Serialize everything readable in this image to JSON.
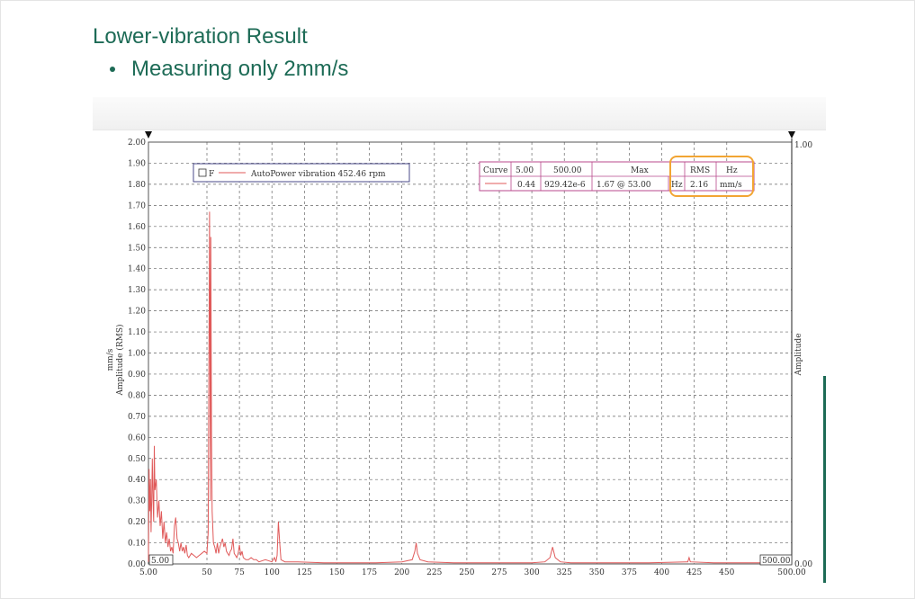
{
  "page": {
    "heading": "Lower-vibration Result",
    "bullet": "Measuring only 2mm/s"
  },
  "chart_data": {
    "type": "line",
    "series": [
      {
        "name": "AutoPower vibration 452.46 rpm",
        "color": "#e05a5a",
        "points": [
          [
            5,
            0.01
          ],
          [
            5.5,
            0.45
          ],
          [
            6,
            0.25
          ],
          [
            6.5,
            0.4
          ],
          [
            7,
            0.15
          ],
          [
            7.5,
            0.3
          ],
          [
            8,
            0.5
          ],
          [
            8.5,
            0.3
          ],
          [
            9,
            0.2
          ],
          [
            9.5,
            0.56
          ],
          [
            10,
            0.35
          ],
          [
            11,
            0.4
          ],
          [
            12,
            0.22
          ],
          [
            13,
            0.3
          ],
          [
            14,
            0.18
          ],
          [
            15,
            0.25
          ],
          [
            16,
            0.12
          ],
          [
            17,
            0.2
          ],
          [
            18,
            0.1
          ],
          [
            19,
            0.15
          ],
          [
            20,
            0.08
          ],
          [
            21,
            0.12
          ],
          [
            22,
            0.06
          ],
          [
            23,
            0.08
          ],
          [
            24,
            0.05
          ],
          [
            25,
            0.18
          ],
          [
            26,
            0.22
          ],
          [
            27,
            0.12
          ],
          [
            28,
            0.1
          ],
          [
            29,
            0.06
          ],
          [
            30,
            0.1
          ],
          [
            31,
            0.06
          ],
          [
            32,
            0.08
          ],
          [
            33,
            0.05
          ],
          [
            34,
            0.09
          ],
          [
            35,
            0.04
          ],
          [
            36,
            0.03
          ],
          [
            38,
            0.05
          ],
          [
            40,
            0.04
          ],
          [
            42,
            0.03
          ],
          [
            44,
            0.04
          ],
          [
            46,
            0.05
          ],
          [
            48,
            0.06
          ],
          [
            50,
            0.05
          ],
          [
            51,
            0.15
          ],
          [
            52,
            1.67
          ],
          [
            52.7,
            0.3
          ],
          [
            53,
            1.55
          ],
          [
            53.5,
            0.6
          ],
          [
            54,
            0.25
          ],
          [
            55,
            0.1
          ],
          [
            56,
            0.08
          ],
          [
            57,
            0.05
          ],
          [
            58,
            0.1
          ],
          [
            59,
            0.05
          ],
          [
            60,
            0.08
          ],
          [
            61,
            0.1
          ],
          [
            62,
            0.12
          ],
          [
            63,
            0.08
          ],
          [
            64,
            0.1
          ],
          [
            65,
            0.06
          ],
          [
            66,
            0.05
          ],
          [
            67,
            0.04
          ],
          [
            68,
            0.06
          ],
          [
            69,
            0.07
          ],
          [
            70,
            0.12
          ],
          [
            71,
            0.05
          ],
          [
            72,
            0.04
          ],
          [
            73,
            0.03
          ],
          [
            74,
            0.05
          ],
          [
            75,
            0.09
          ],
          [
            76,
            0.04
          ],
          [
            77,
            0.06
          ],
          [
            78,
            0.03
          ],
          [
            80,
            0.02
          ],
          [
            82,
            0.02
          ],
          [
            84,
            0.03
          ],
          [
            86,
            0.02
          ],
          [
            88,
            0.02
          ],
          [
            90,
            0.01
          ],
          [
            95,
            0.02
          ],
          [
            100,
            0.01
          ],
          [
            102,
            0.03
          ],
          [
            103,
            0.01
          ],
          [
            104,
            0.04
          ],
          [
            105,
            0.2
          ],
          [
            106,
            0.1
          ],
          [
            107,
            0.02
          ],
          [
            110,
            0.01
          ],
          [
            120,
            0.01
          ],
          [
            140,
            0.005
          ],
          [
            160,
            0.005
          ],
          [
            180,
            0.005
          ],
          [
            200,
            0.01
          ],
          [
            208,
            0.02
          ],
          [
            210,
            0.06
          ],
          [
            211,
            0.1
          ],
          [
            212,
            0.05
          ],
          [
            214,
            0.02
          ],
          [
            220,
            0.01
          ],
          [
            240,
            0.005
          ],
          [
            260,
            0.005
          ],
          [
            280,
            0.005
          ],
          [
            300,
            0.005
          ],
          [
            310,
            0.01
          ],
          [
            314,
            0.03
          ],
          [
            316,
            0.08
          ],
          [
            318,
            0.03
          ],
          [
            322,
            0.01
          ],
          [
            330,
            0.005
          ],
          [
            360,
            0.005
          ],
          [
            390,
            0.005
          ],
          [
            420,
            0.01
          ],
          [
            421,
            0.03
          ],
          [
            422,
            0.01
          ],
          [
            440,
            0.005
          ],
          [
            460,
            0.005
          ],
          [
            480,
            0.005
          ],
          [
            500,
            0.005
          ]
        ]
      }
    ],
    "x_range": [
      5,
      500
    ],
    "x_ticks": [
      5,
      50,
      75,
      100,
      125,
      150,
      175,
      200,
      225,
      250,
      275,
      300,
      325,
      350,
      375,
      400,
      425,
      450,
      500
    ],
    "x_tick_labels": [
      "5.00",
      "50",
      "75",
      "100",
      "125",
      "150",
      "175",
      "200",
      "225",
      "250",
      "275",
      "300",
      "325",
      "350",
      "375",
      "400",
      "425",
      "450",
      "500.00"
    ],
    "y_range": [
      0,
      2
    ],
    "y_ticks": [
      "0.00",
      "0.10",
      "0.20",
      "0.30",
      "0.40",
      "0.50",
      "0.60",
      "0.70",
      "0.80",
      "0.90",
      "1.00",
      "1.10",
      "1.20",
      "1.30",
      "1.40",
      "1.50",
      "1.60",
      "1.70",
      "1.80",
      "1.90",
      "2.00"
    ],
    "ylabel_left": "Amplitude (RMS)",
    "ylabel_unit": "mm/s",
    "ylabel_right": "Amplitude",
    "right_axis_top": "1.00",
    "right_axis_bottom": "0.00",
    "cursor_left_label": "5.00",
    "cursor_right_label": "500.00",
    "legend": {
      "checkbox_label": "F",
      "series_label": "AutoPower vibration 452.46 rpm"
    },
    "table": {
      "headers": [
        "Curve",
        "5.00",
        "500.00",
        "Max",
        "RMS",
        "Hz"
      ],
      "row": [
        "",
        "0.44",
        "929.42e-6",
        "1.67 @ 53.00",
        "Hz",
        "2.16",
        "mm/s"
      ]
    },
    "highlight_color": "#f2a533",
    "grid": true
  }
}
